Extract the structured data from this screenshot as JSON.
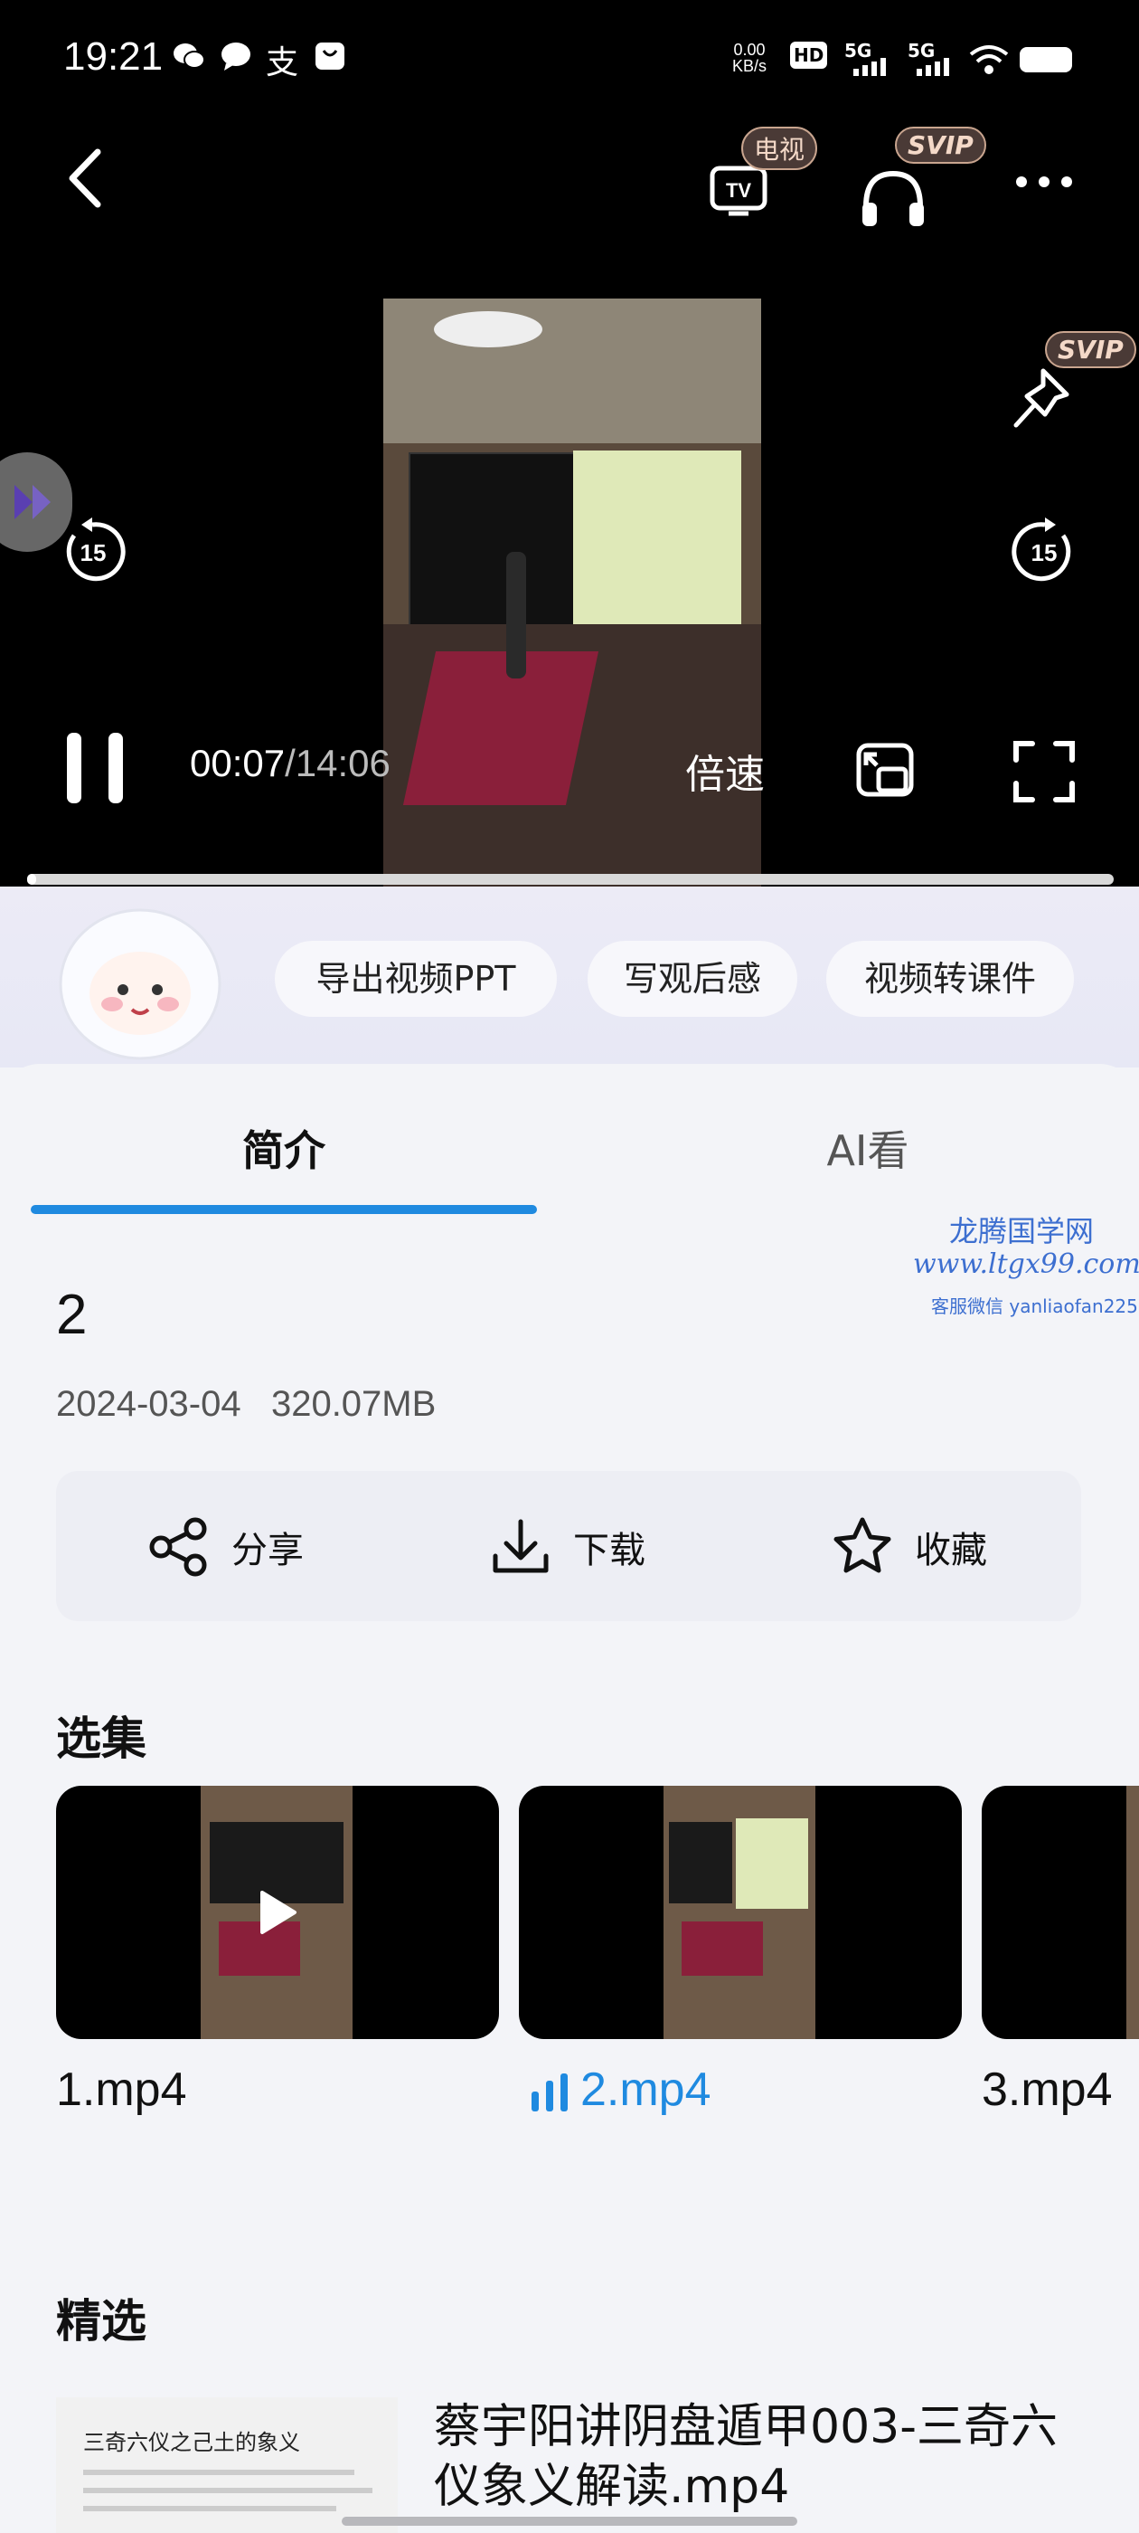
{
  "status_bar": {
    "time": "19:21",
    "net_speed_top": "0.00",
    "net_speed_bottom": "KB/s",
    "hd_label": "HD",
    "signal1": "5G",
    "signal2": "5G"
  },
  "player": {
    "tv_badge": "电视",
    "svip_badge_audio": "SVIP",
    "svip_badge_pin": "SVIP",
    "rewind_seconds": "15",
    "forward_seconds": "15",
    "current_time": "00:07",
    "duration": "/14:06",
    "speed_label": "倍速",
    "progress_fraction": 0.008
  },
  "ai_actions": [
    {
      "label": "导出视频PPT"
    },
    {
      "label": "写观后感"
    },
    {
      "label": "视频转课件"
    }
  ],
  "tabs": [
    {
      "label": "简介"
    },
    {
      "label": "AI看"
    }
  ],
  "watermark": {
    "line1": "龙腾国学网",
    "line2": "www.ltgx99.com",
    "line3": "客服微信 yanliaofan225"
  },
  "episode": {
    "title": "2",
    "date": "2024-03-04",
    "size": "320.07MB"
  },
  "actions": {
    "share": "分享",
    "download": "下载",
    "favorite": "收藏"
  },
  "episodes_section": {
    "title": "选集",
    "items": [
      {
        "label": "1.mp4"
      },
      {
        "label": "2.mp4"
      },
      {
        "label": "3.mp4"
      }
    ]
  },
  "featured_section": {
    "title": "精选",
    "item_title": "蔡宇阳讲阴盘遁甲003-三奇六仪象义解读.mp4",
    "thumb_caption": "三奇六仪之己土的象义"
  },
  "colors": {
    "accent": "#1f8ae0",
    "background": "#f3f4f8",
    "player_bg": "#000000"
  }
}
